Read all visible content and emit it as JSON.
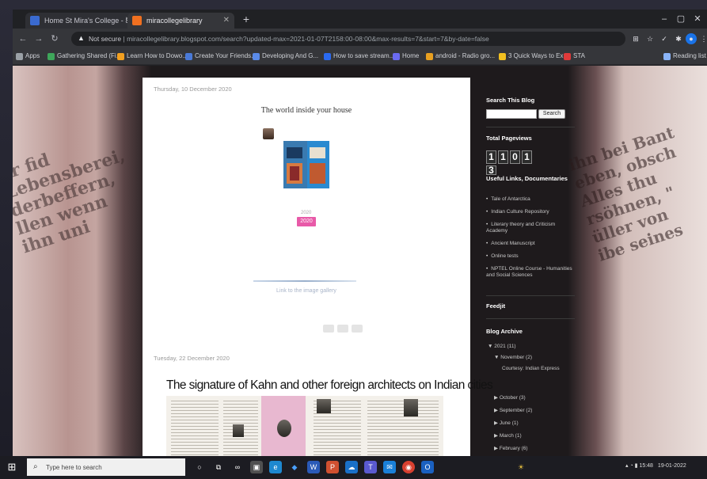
{
  "browser": {
    "tabs": [
      {
        "label": "Home St Mira's College - STM...",
        "active": false
      },
      {
        "label": "miracollegelibrary",
        "active": true
      }
    ],
    "new_tab_label": "+",
    "url_prefix": "Not secure",
    "url": "miracollegelibrary.blogspot.com/search?updated-max=2021-01-07T2158:00-08:00&max-results=7&start=7&by-date=false",
    "bookmarks": [
      "Apps",
      "Gathering Shared (Fi...",
      "Learn How to Dowo...",
      "Create Your Friends...",
      "Developing And G...",
      "How to save stream...",
      "Home",
      "android - Radio gro...",
      "3 Quick Ways to Ex...",
      "STA"
    ],
    "reading_list": "Reading list"
  },
  "posts": [
    {
      "date": "Thursday, 10 December 2020",
      "title": "The world inside your house",
      "year_tag": "2020",
      "caption": "Link to the image gallery"
    },
    {
      "date": "Tuesday, 22 December 2020",
      "title": "The signature of Kahn and other foreign architects on Indian cities"
    }
  ],
  "sidebar": {
    "search_heading": "Search This Blog",
    "search_button": "Search",
    "pageviews_heading": "Total Pageviews",
    "pageviews_digits": [
      "1",
      "1",
      "0",
      "1",
      "3"
    ],
    "useful_links_heading": "Useful Links, Documentaries",
    "useful_links": [
      "Tale of Antarctica",
      "Indian Culture Repository",
      "Literary theory and Criticism Academy",
      "Ancient Manuscript",
      "Online tests",
      "NPTEL Online Course - Humanities and Social Sciences"
    ],
    "feedjit_heading": "Feedjit",
    "archive_heading": "Blog Archive",
    "archive": [
      {
        "label": "2021 (11)",
        "level": 0
      },
      {
        "label": "November (2)",
        "level": 1
      },
      {
        "label": "Courtesy: Indian Express",
        "level": 2
      },
      {
        "label": "October (3)",
        "level": 1
      },
      {
        "label": "September (2)",
        "level": 1
      },
      {
        "label": "June (1)",
        "level": 1
      },
      {
        "label": "March (1)",
        "level": 1
      },
      {
        "label": "February (6)",
        "level": 1
      }
    ]
  },
  "taskbar": {
    "search_placeholder": "Type here to search",
    "clock_time": "15:48",
    "clock_date": "19-01-2022"
  }
}
